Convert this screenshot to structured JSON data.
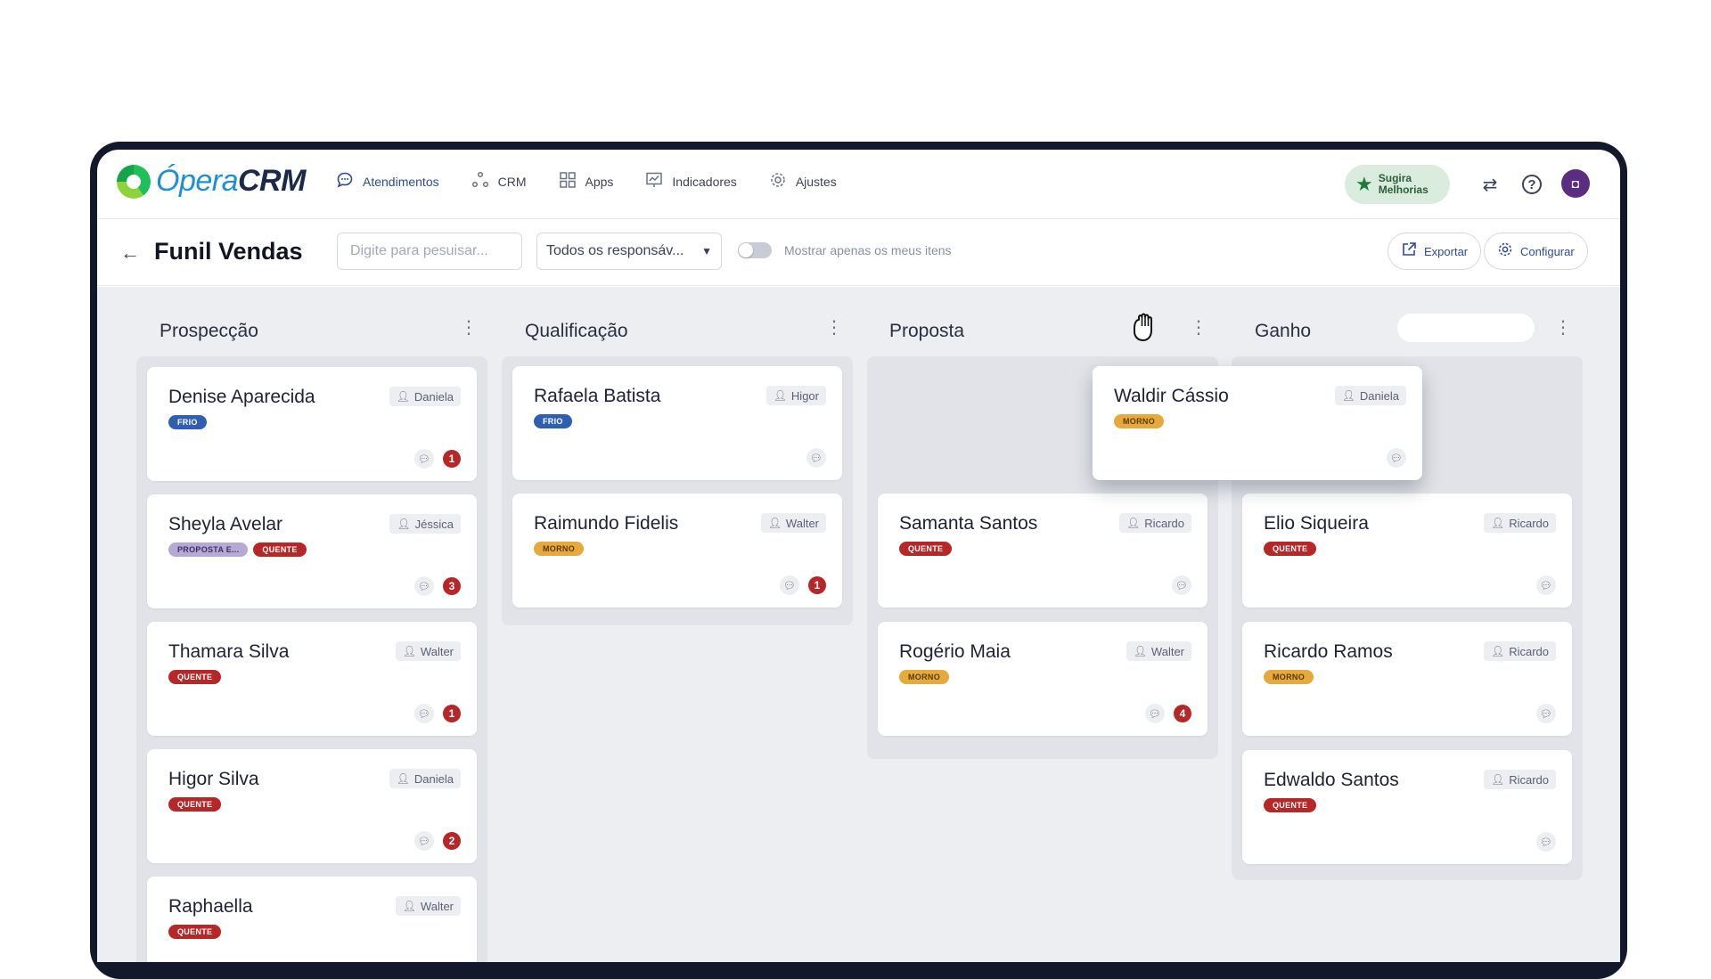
{
  "app": {
    "logo_part1": "Ópera",
    "logo_part2": "CRM"
  },
  "nav": [
    {
      "label": "Atendimentos",
      "icon": "chat-bubble-icon"
    },
    {
      "label": "CRM",
      "icon": "nodes-icon"
    },
    {
      "label": "Apps",
      "icon": "grid-icon"
    },
    {
      "label": "Indicadores",
      "icon": "chart-board-icon"
    },
    {
      "label": "Ajustes",
      "icon": "gear-icon"
    }
  ],
  "header_right": {
    "suggest_line1": "Sugira",
    "suggest_line2": "Melhorias",
    "avatar_glyph": "◘"
  },
  "toolbar": {
    "title": "Funil Vendas",
    "search_placeholder": "Digite para pesuisar...",
    "responsible_value": "Todos os responsáv...",
    "toggle_label": "Mostrar apenas os meus itens",
    "export_label": "Exportar",
    "configure_label": "Configurar"
  },
  "columns": [
    {
      "title": "Prospecção",
      "cards": [
        {
          "name": "Denise Aparecida",
          "owner": "Daniela",
          "tags": [
            {
              "text": "FRIO",
              "kind": "frio"
            }
          ],
          "messages": "1"
        },
        {
          "name": "Sheyla Avelar",
          "owner": "Jéssica",
          "tags": [
            {
              "text": "PROPOSTA E...",
              "kind": "proposta"
            },
            {
              "text": "QUENTE",
              "kind": "quente"
            }
          ],
          "messages": "3"
        },
        {
          "name": "Thamara Silva",
          "owner": "Walter",
          "tags": [
            {
              "text": "QUENTE",
              "kind": "quente"
            }
          ],
          "messages": "1"
        },
        {
          "name": "Higor Silva",
          "owner": "Daniela",
          "tags": [
            {
              "text": "QUENTE",
              "kind": "quente"
            }
          ],
          "messages": "2"
        },
        {
          "name": "Raphaella",
          "owner": "Walter",
          "tags": [
            {
              "text": "QUENTE",
              "kind": "quente"
            }
          ],
          "messages": ""
        }
      ]
    },
    {
      "title": "Qualificação",
      "cards": [
        {
          "name": "Rafaela Batista",
          "owner": "Higor",
          "tags": [
            {
              "text": "FRIO",
              "kind": "frio"
            }
          ],
          "messages": ""
        },
        {
          "name": "Raimundo Fidelis",
          "owner": "Walter",
          "tags": [
            {
              "text": "MORNO",
              "kind": "morno"
            }
          ],
          "messages": "1"
        }
      ]
    },
    {
      "title": "Proposta",
      "cards": [
        {
          "name": "Samanta Santos",
          "owner": "Ricardo",
          "tags": [
            {
              "text": "QUENTE",
              "kind": "quente"
            }
          ],
          "messages": ""
        },
        {
          "name": "Rogério Maia",
          "owner": "Walter",
          "tags": [
            {
              "text": "MORNO",
              "kind": "morno"
            }
          ],
          "messages": "4"
        }
      ]
    },
    {
      "title": "Ganho",
      "cards": [
        {
          "name": "Elio Siqueira",
          "owner": "Ricardo",
          "tags": [
            {
              "text": "QUENTE",
              "kind": "quente"
            }
          ],
          "messages": ""
        },
        {
          "name": "Ricardo Ramos",
          "owner": "Ricardo",
          "tags": [
            {
              "text": "MORNO",
              "kind": "morno"
            }
          ],
          "messages": ""
        },
        {
          "name": "Edwaldo Santos",
          "owner": "Ricardo",
          "tags": [
            {
              "text": "QUENTE",
              "kind": "quente"
            }
          ],
          "messages": ""
        }
      ]
    }
  ],
  "dragging_card": {
    "name": "Waldir Cássio",
    "owner": "Daniela",
    "tags": [
      {
        "text": "MORNO",
        "kind": "morno"
      }
    ],
    "messages": ""
  },
  "colors": {
    "accent": "#2d4a9a",
    "hot": "#b62828",
    "cold": "#2f5fb3",
    "warm": "#e5a93c",
    "board_bg": "#eceef2"
  }
}
